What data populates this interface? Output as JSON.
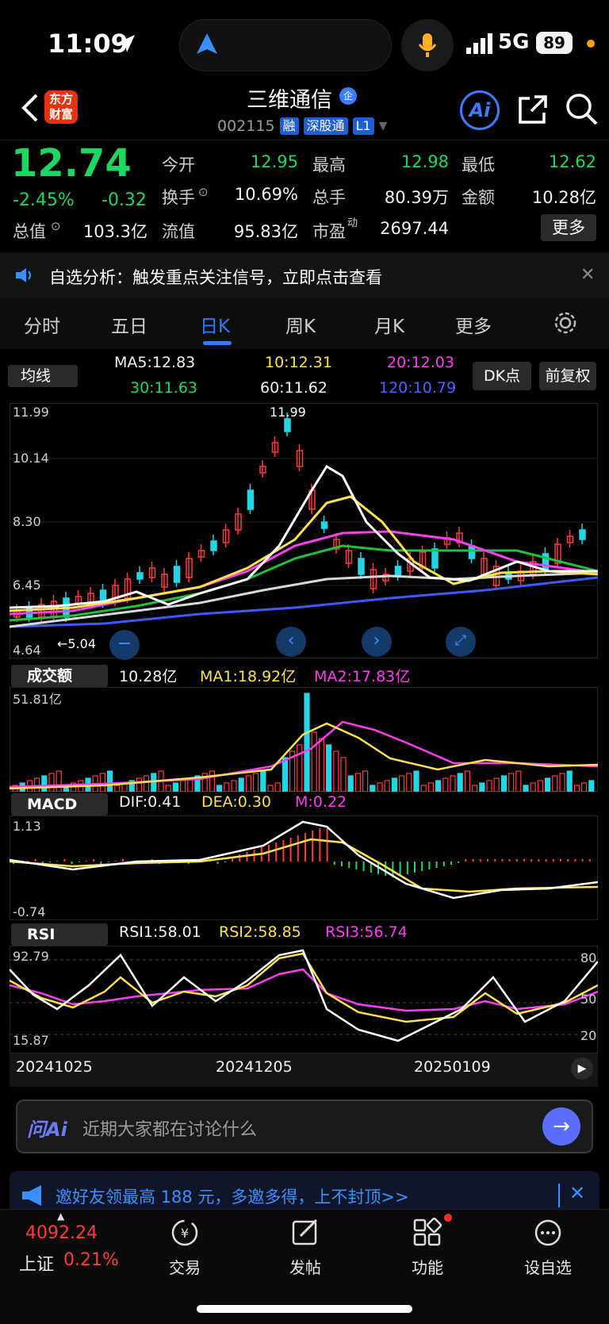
{
  "status_bar": {
    "time": "11:09",
    "network": "5G",
    "battery": "89"
  },
  "header": {
    "logo_line1": "东方",
    "logo_line2": "财富",
    "stock_name": "三维通信",
    "name_badge": "企",
    "stock_code": "002115",
    "tags": [
      "融",
      "深股通",
      "L1"
    ]
  },
  "quote": {
    "price": "12.74",
    "change_pct": "-2.45%",
    "change": "-0.32",
    "fields": {
      "open_label": "今开",
      "open": "12.95",
      "high_label": "最高",
      "high": "12.98",
      "low_label": "最低",
      "low": "12.62",
      "turnover_label": "换手",
      "turnover": "10.69%",
      "volume_label": "总手",
      "volume": "80.39万",
      "amount_label": "金额",
      "amount": "10.28亿",
      "mktcap_label": "总值",
      "mktcap": "103.3亿",
      "float_label": "流值",
      "float_cap": "95.83亿",
      "pe_label": "市盈",
      "pe_sup": "动",
      "pe": "2697.44"
    },
    "more_label": "更多"
  },
  "notice": {
    "text": "自选分析：触发重点关注信号，立即点击查看"
  },
  "tabs": [
    "分时",
    "五日",
    "日K",
    "周K",
    "月K",
    "更多"
  ],
  "ma": {
    "dropdown": "均线",
    "ma5": "MA5:12.83",
    "ma10": "10:12.31",
    "ma20": "20:12.03",
    "ma30": "30:11.63",
    "ma60": "60:11.62",
    "ma120": "120:10.79",
    "dk_label": "DK点",
    "fq_label": "前复权",
    "y_labels": [
      "11.99",
      "10.14",
      "8.30",
      "6.45",
      "4.64"
    ],
    "high_marker": "11.99",
    "low_marker": "←5.04"
  },
  "volume": {
    "dropdown": "成交额",
    "value": "10.28亿",
    "ma1": "MA1:18.92亿",
    "ma2": "MA2:17.83亿",
    "y_max": "51.81亿"
  },
  "macd": {
    "dropdown": "MACD",
    "dif": "DIF:0.41",
    "dea": "DEA:0.30",
    "m": "M:0.22",
    "y_max": "1.13",
    "y_min": "-0.74"
  },
  "rsi": {
    "dropdown": "RSI",
    "rsi1": "RSI1:58.01",
    "rsi2": "RSI2:58.85",
    "rsi3": "RSI3:56.74",
    "y_max": "92.79",
    "y_min": "15.87",
    "r80": "80",
    "r50": "50",
    "r20": "20"
  },
  "dates": [
    "20241025",
    "20241205",
    "20250109"
  ],
  "ai_bar": {
    "logo": "问Ai",
    "placeholder": "近期大家都在讨论什么"
  },
  "invite": {
    "text": "邀好友领最高 188 元，多邀多得，上不封顶>>"
  },
  "bottom_nav": {
    "index_value": "4092.24",
    "index_name": "上证",
    "index_pct": "0.21%",
    "items": [
      "交易",
      "发帖",
      "功能",
      "设自选"
    ]
  },
  "colors": {
    "up": "#ff3b3b",
    "down": "#1ed760",
    "accent": "#2f7bff"
  }
}
